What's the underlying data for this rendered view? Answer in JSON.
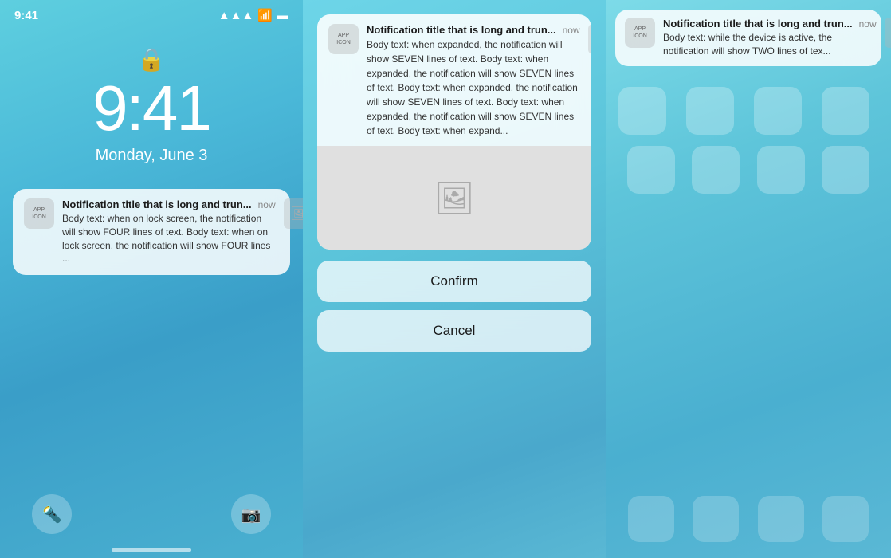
{
  "left": {
    "time": "9:41",
    "date": "Monday, June 3",
    "status_time": "9:41",
    "notification": {
      "title": "Notification title that is long and trun...",
      "time": "now",
      "body": "Body text: when on lock screen, the notification will show FOUR lines of text. Body text: when on lock screen, the notification will show FOUR lines ..."
    },
    "flashlight_icon": "🔦",
    "camera_icon": "📷"
  },
  "middle": {
    "notification": {
      "title": "Notification title that is long and trun...",
      "time": "now",
      "body": "Body text: when expanded, the notification will show SEVEN lines of text. Body text: when expanded, the notification will show SEVEN lines of text. Body text: when expanded, the notification will show SEVEN lines of text. Body text: when expanded, the notification will show SEVEN lines of text. Body text: when expand..."
    },
    "confirm_label": "Confirm",
    "cancel_label": "Cancel"
  },
  "right": {
    "notification": {
      "title": "Notification title that is long and trun...",
      "time": "now",
      "body": "Body text: while the device is active, the notification will show TWO lines of tex..."
    }
  },
  "icons": {
    "app_label_line1": "APP",
    "app_label_line2": "ICON",
    "image_symbol": "🖼",
    "lock_symbol": "🔒",
    "wifi_symbol": "▲",
    "signal_bars": "●●●",
    "battery": "▮▮▮"
  }
}
